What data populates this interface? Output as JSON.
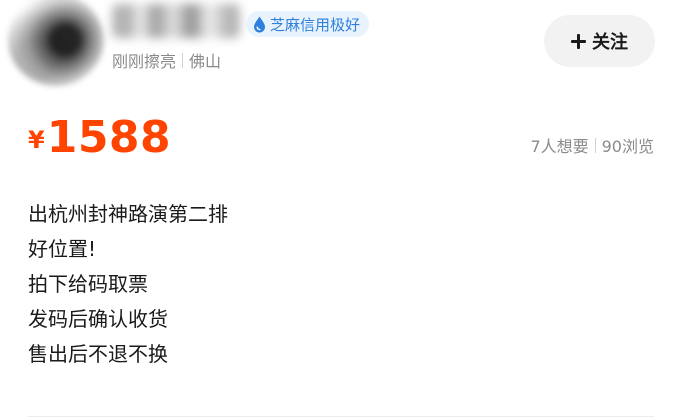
{
  "seller": {
    "credit_badge": "芝麻信用极好",
    "credit_icon": "sesame-credit-drop-icon",
    "active_status": "刚刚擦亮",
    "location": "佛山",
    "follow_label": "关注",
    "follow_icon": "plus-icon"
  },
  "listing": {
    "currency_symbol": "¥",
    "price": "1588",
    "wants": "7人想要",
    "views": "90浏览",
    "description": [
      "出杭州封神路演第二排",
      "好位置!",
      "拍下给码取票",
      "发码后确认收货",
      "售出后不退不换"
    ]
  },
  "colors": {
    "price": "#ff4400",
    "credit_badge_bg": "#e9f3fd",
    "credit_badge_text": "#2f80dc",
    "follow_button_bg": "#f2f2f2",
    "muted_text": "#8a8a8a"
  }
}
